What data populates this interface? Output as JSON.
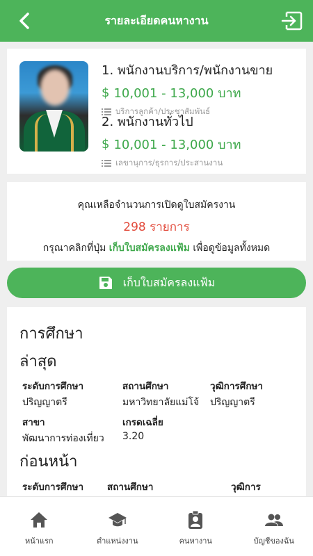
{
  "header": {
    "title": "รายละเอียดคนหางาน",
    "back_icon": "chevron-left-icon",
    "exit_icon": "logout-icon"
  },
  "profile": {
    "jobs": [
      {
        "title": "1. พนักงานบริการ/พนักงานขาย",
        "currency_icon": "$",
        "salary": "10,001 - 13,000 บาท",
        "category": "บริการลูกค้า/ประชาสัมพันธ์"
      },
      {
        "title": "2. พนักงานทั่วไป",
        "currency_icon": "$",
        "salary": "10,001 - 13,000 บาท",
        "category": "เลขานุการ/ธุรการ/ประสานงาน"
      }
    ]
  },
  "quota": {
    "line1": "คุณเหลือจำนวนการเปิดดูใบสมัครงาน",
    "count": "298 รายการ",
    "line3_before": "กรุณาคลิกที่ปุ่ม ",
    "line3_link": "เก็บใบสมัครลงแฟ้ม",
    "line3_after": " เพื่อดูข้อมูลทั้งหมด"
  },
  "save_button": {
    "label": "เก็บใบสมัครลงแฟ้ม"
  },
  "education": {
    "title": "การศึกษา",
    "latest": {
      "heading": "ล่าสุด",
      "level_label": "ระดับการศึกษา",
      "level_value": "ปริญญาตรี",
      "school_label": "สถานศึกษา",
      "school_value": "มหาวิทยาลัยแม่โจ้",
      "degree_label": "วุฒิการศึกษา",
      "degree_value": "ปริญญาตรี",
      "major_label": "สาขา",
      "major_value": "พัฒนาการท่องเที่ยว",
      "gpa_label": "เกรดเฉลี่ย",
      "gpa_value": "3.20"
    },
    "previous": {
      "heading": "ก่อนหน้า",
      "level_label": "ระดับการศึกษา",
      "school_label": "สถานศึกษา",
      "degree_label": "วุฒิการ"
    }
  },
  "nav": {
    "items": [
      {
        "label": "หน้าแรก",
        "icon": "home-icon"
      },
      {
        "label": "ตำแหน่งงาน",
        "icon": "graduation-cap-icon"
      },
      {
        "label": "คนหางาน",
        "icon": "id-badge-icon"
      },
      {
        "label": "บัญชีของฉัน",
        "icon": "users-icon"
      }
    ]
  },
  "colors": {
    "brand_green": "#4db45a",
    "salary_green": "#3ea84b",
    "count_red": "#e24a3b"
  }
}
